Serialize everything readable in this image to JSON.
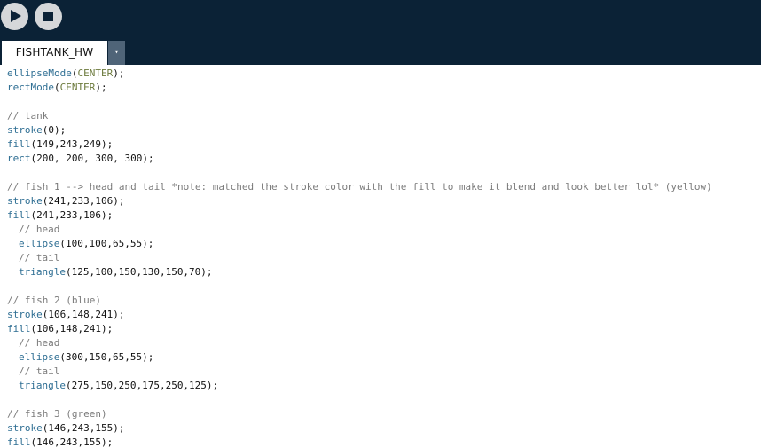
{
  "toolbar": {
    "run_icon": "play-icon",
    "stop_icon": "stop-icon"
  },
  "tabs": [
    {
      "label": "FISHTANK_HW",
      "active": true
    }
  ],
  "tab_menu": {
    "glyph": "▾"
  },
  "colors": {
    "toolbar_bg": "#0b2236",
    "function": "#2e6e93",
    "constant": "#6c7a3c",
    "comment": "#7b7b7b"
  },
  "code": {
    "lines": [
      {
        "indent": 0,
        "parts": [
          {
            "t": "ellipseMode",
            "c": "fn"
          },
          {
            "t": "(",
            "c": ""
          },
          {
            "t": "CENTER",
            "c": "kw"
          },
          {
            "t": ");",
            "c": ""
          }
        ]
      },
      {
        "indent": 0,
        "parts": [
          {
            "t": "rectMode",
            "c": "fn"
          },
          {
            "t": "(",
            "c": ""
          },
          {
            "t": "CENTER",
            "c": "kw"
          },
          {
            "t": ");",
            "c": ""
          }
        ]
      },
      {
        "indent": 0,
        "parts": []
      },
      {
        "indent": 0,
        "parts": [
          {
            "t": "// tank",
            "c": "cm"
          }
        ]
      },
      {
        "indent": 0,
        "parts": [
          {
            "t": "stroke",
            "c": "fn"
          },
          {
            "t": "(0);",
            "c": ""
          }
        ]
      },
      {
        "indent": 0,
        "parts": [
          {
            "t": "fill",
            "c": "fn"
          },
          {
            "t": "(149,243,249);",
            "c": ""
          }
        ]
      },
      {
        "indent": 0,
        "parts": [
          {
            "t": "rect",
            "c": "fn"
          },
          {
            "t": "(200, 200, 300, 300);",
            "c": ""
          }
        ]
      },
      {
        "indent": 0,
        "parts": []
      },
      {
        "indent": 0,
        "parts": [
          {
            "t": "// fish 1 --> head and tail *note: matched the stroke color with the fill to make it blend and look better lol* (yellow)",
            "c": "cm"
          }
        ]
      },
      {
        "indent": 0,
        "parts": [
          {
            "t": "stroke",
            "c": "fn"
          },
          {
            "t": "(241,233,106);",
            "c": ""
          }
        ]
      },
      {
        "indent": 0,
        "parts": [
          {
            "t": "fill",
            "c": "fn"
          },
          {
            "t": "(241,233,106);",
            "c": ""
          }
        ]
      },
      {
        "indent": 1,
        "parts": [
          {
            "t": "// head",
            "c": "cm"
          }
        ]
      },
      {
        "indent": 1,
        "parts": [
          {
            "t": "ellipse",
            "c": "fn"
          },
          {
            "t": "(100,100,65,55);",
            "c": ""
          }
        ]
      },
      {
        "indent": 1,
        "parts": [
          {
            "t": "// tail",
            "c": "cm"
          }
        ]
      },
      {
        "indent": 1,
        "parts": [
          {
            "t": "triangle",
            "c": "fn"
          },
          {
            "t": "(125,100,150,130,150,70);",
            "c": ""
          }
        ]
      },
      {
        "indent": 0,
        "parts": []
      },
      {
        "indent": 0,
        "parts": [
          {
            "t": "// fish 2 (blue)",
            "c": "cm"
          }
        ]
      },
      {
        "indent": 0,
        "parts": [
          {
            "t": "stroke",
            "c": "fn"
          },
          {
            "t": "(106,148,241);",
            "c": ""
          }
        ]
      },
      {
        "indent": 0,
        "parts": [
          {
            "t": "fill",
            "c": "fn"
          },
          {
            "t": "(106,148,241);",
            "c": ""
          }
        ]
      },
      {
        "indent": 1,
        "parts": [
          {
            "t": "// head",
            "c": "cm"
          }
        ]
      },
      {
        "indent": 1,
        "parts": [
          {
            "t": "ellipse",
            "c": "fn"
          },
          {
            "t": "(300,150,65,55);",
            "c": ""
          }
        ]
      },
      {
        "indent": 1,
        "parts": [
          {
            "t": "// tail",
            "c": "cm"
          }
        ]
      },
      {
        "indent": 1,
        "parts": [
          {
            "t": "triangle",
            "c": "fn"
          },
          {
            "t": "(275,150,250,175,250,125);",
            "c": ""
          }
        ]
      },
      {
        "indent": 0,
        "parts": []
      },
      {
        "indent": 0,
        "parts": [
          {
            "t": "// fish 3 (green)",
            "c": "cm"
          }
        ]
      },
      {
        "indent": 0,
        "parts": [
          {
            "t": "stroke",
            "c": "fn"
          },
          {
            "t": "(146,243,155);",
            "c": ""
          }
        ]
      },
      {
        "indent": 0,
        "parts": [
          {
            "t": "fill",
            "c": "fn"
          },
          {
            "t": "(146,243,155);",
            "c": ""
          }
        ]
      }
    ]
  }
}
